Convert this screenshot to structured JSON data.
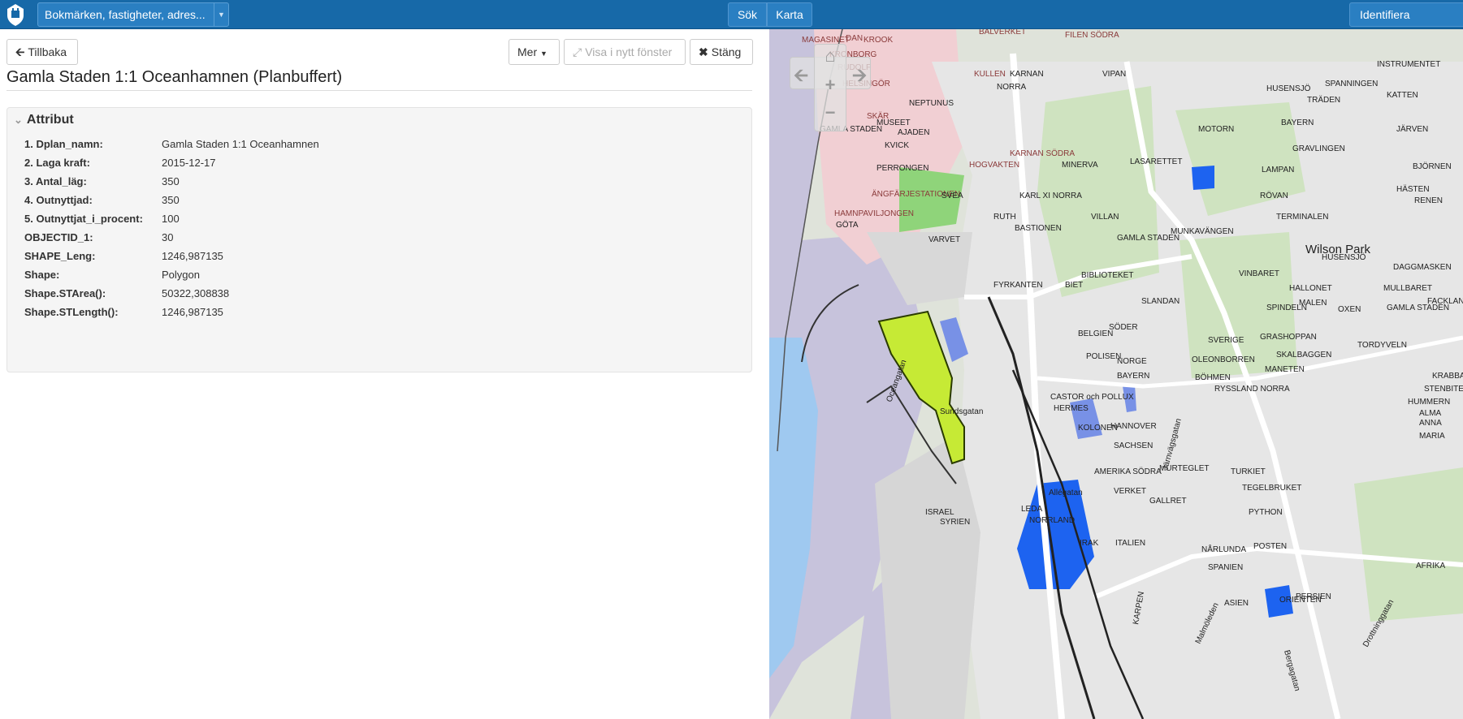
{
  "navbar": {
    "search_value": "Bokmärken, fastigheter, adres...",
    "sok": "Sök",
    "karta": "Karta",
    "identifiera": "Identifiera"
  },
  "toolbar": {
    "back": "Tillbaka",
    "mer": "Mer",
    "visa": "Visa i nytt fönster",
    "stang": "Stäng"
  },
  "title": "Gamla Staden 1:1 Oceanhamnen (Planbuffert)",
  "attributes": {
    "heading": "Attribut",
    "rows": [
      {
        "key": "1. Dplan_namn:",
        "value": "Gamla Staden 1:1 Oceanhamnen"
      },
      {
        "key": "2. Laga kraft:",
        "value": "2015-12-17"
      },
      {
        "key": "3. Antal_läg:",
        "value": "350"
      },
      {
        "key": "4. Outnyttjad:",
        "value": "350"
      },
      {
        "key": "5. Outnyttjat_i_procent:",
        "value": "100"
      },
      {
        "key": "OBJECTID_1:",
        "value": "30"
      },
      {
        "key": "SHAPE_Leng:",
        "value": "1246,987135"
      },
      {
        "key": "Shape:",
        "value": "Polygon"
      },
      {
        "key": "Shape.STArea():",
        "value": "50322,308838"
      },
      {
        "key": "Shape.STLength():",
        "value": "1246,987135"
      }
    ]
  },
  "map_labels": [
    "MAGASINET",
    "DAN",
    "KROOK",
    "BALVERKET",
    "FILEN SÖDRA",
    "KRONBORG",
    "RUDOLF",
    "HELSINGÖR",
    "SKÄR",
    "KULLEN",
    "NORRA",
    "KARNAN",
    "NEPTUNUS",
    "VIPAN",
    "INSTRUMENTET",
    "SPANNINGEN",
    "TRÄDEN",
    "KATTEN",
    "HUSENSJÖ",
    "MUSEET",
    "GAMLA STADEN",
    "AJADEN",
    "MINERVA",
    "LASARETTET",
    "KVICK",
    "PERRONGEN",
    "ÄNGFÄRJESTATIONEN",
    "HOGVAKTEN",
    "KARNAN SÖDRA",
    "SVEA",
    "KARL XI NORRA",
    "MOTORN",
    "BAYERN",
    "LAMPAN",
    "JÄRVEN",
    "GRAVLINGEN",
    "RÖVAN",
    "BJÖRNEN",
    "HÄSTEN",
    "RENEN",
    "HAMNPAVILJONGEN",
    "GÖTA",
    "RUTH",
    "BASTIONEN",
    "VILLAN",
    "GAMLA STADEN",
    "MUNKAVÄNGEN",
    "TERMINALEN",
    "VARVET",
    "FYRKANTEN",
    "BIBLIOTEKET",
    "BIET",
    "SLANDAN",
    "VINBARET",
    "HUSENSJÖ",
    "Wilson Park",
    "DAGGMASKEN",
    "HALLONET",
    "MULLBARET",
    "MALEN",
    "SPINDELN",
    "OXEN",
    "GAMLA STADEN",
    "SÖDER",
    "BELGIEN",
    "POLISEN",
    "NORGE",
    "BAYERN",
    "SVERIGE",
    "OLEONBORREN",
    "SKALBAGGEN",
    "GRASHOPPAN",
    "TORDYVELN",
    "MANETEN",
    "BÖHMEN",
    "RYSSLAND NORRA",
    "FACKLAN",
    "KRABBAN",
    "STENBITEN",
    "HUMMERN",
    "ALMA",
    "ANNA",
    "MARIA",
    "CASTOR och POLLUX",
    "HERMES",
    "KOLONEN",
    "HANNOVER",
    "SACHSEN",
    "AMERIKA SÖDRA",
    "MURTEGLET",
    "TURKIET",
    "TEGELBRUKET",
    "PYTHON",
    "LEDA",
    "NORRLAND",
    "VERKET",
    "GALLRET",
    "ISRAEL",
    "SYRIEN",
    "IRAK",
    "ITALIEN",
    "SPANIEN",
    "NÅRLUNDA",
    "POSTEN",
    "AFRIKA",
    "ASIEN",
    "ORIENTEN",
    "PERSIEN",
    "KARPEN",
    "Malmöleden",
    "Bergagatan",
    "Drottninggatan",
    "Järnvägsgatan",
    "Oceangatan",
    "Sundsgatan",
    "Allégatan"
  ]
}
